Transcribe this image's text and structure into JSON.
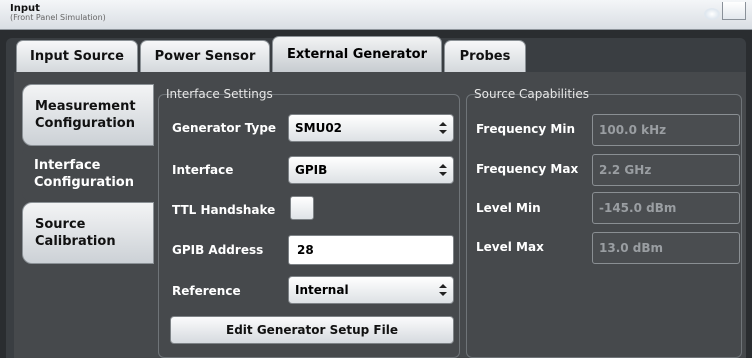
{
  "window": {
    "title": "Input",
    "subtitle": "(Front Panel Simulation)"
  },
  "tabs": [
    {
      "label": "Input Source",
      "active": false
    },
    {
      "label": "Power Sensor",
      "active": false
    },
    {
      "label": "External Generator",
      "active": true
    },
    {
      "label": "Probes",
      "active": false
    }
  ],
  "side_tabs": [
    {
      "label_line1": "Measurement",
      "label_line2": "Configuration",
      "active": false
    },
    {
      "label_line1": "Interface",
      "label_line2": "Configuration",
      "active": true
    },
    {
      "label_line1": "Source",
      "label_line2": "Calibration",
      "active": false
    }
  ],
  "interface_settings": {
    "title": "Interface Settings",
    "generator_type": {
      "label": "Generator Type",
      "value": "SMU02"
    },
    "interface": {
      "label": "Interface",
      "value": "GPIB"
    },
    "ttl_handshake": {
      "label": "TTL Handshake",
      "checked": false
    },
    "gpib_address": {
      "label": "GPIB Address",
      "value": "28"
    },
    "reference": {
      "label": "Reference",
      "value": "Internal"
    },
    "edit_button": "Edit Generator Setup File"
  },
  "source_capabilities": {
    "title": "Source Capabilities",
    "frequency_min": {
      "label": "Frequency Min",
      "value": "100.0 kHz"
    },
    "frequency_max": {
      "label": "Frequency Max",
      "value": "2.2 GHz"
    },
    "level_min": {
      "label": "Level Min",
      "value": "-145.0 dBm"
    },
    "level_max": {
      "label": "Level Max",
      "value": "13.0 dBm"
    }
  },
  "colors": {
    "background": "#46494c",
    "tab_face": "#e4e7ea",
    "readonly_text": "#9a9ea2"
  }
}
